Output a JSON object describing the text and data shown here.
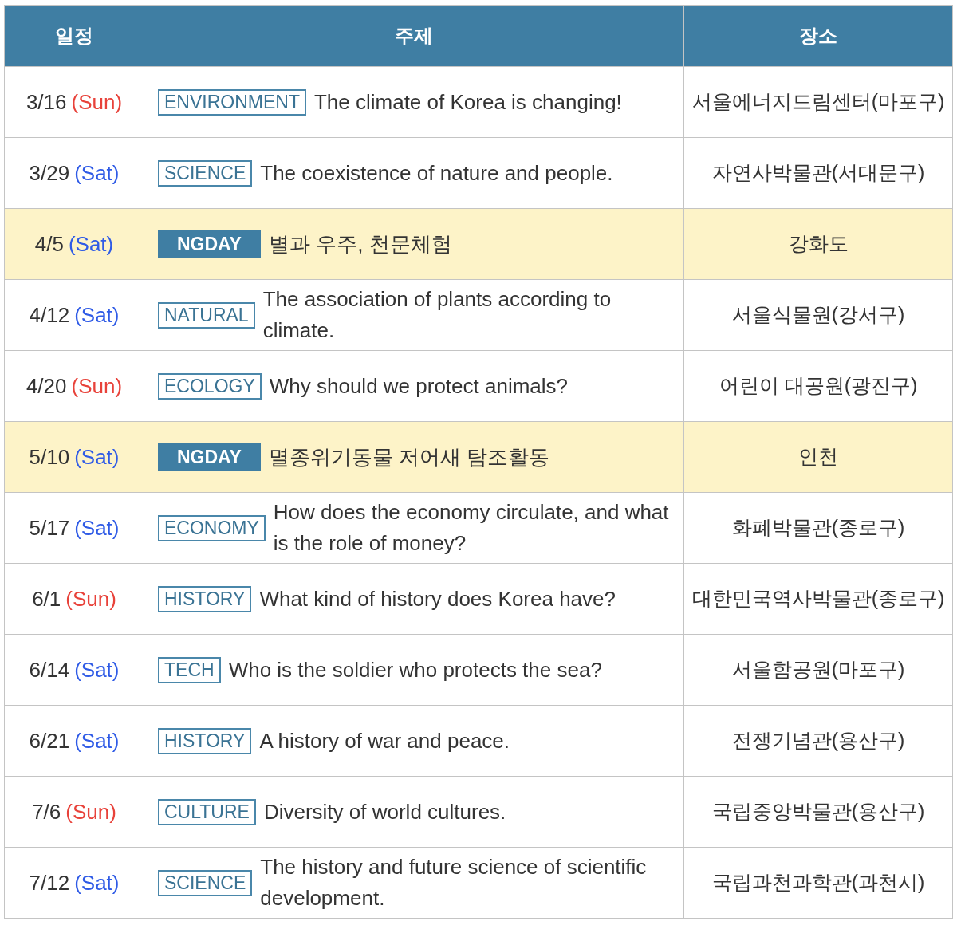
{
  "table": {
    "columns": [
      "일정",
      "주제",
      "장소"
    ],
    "rows": [
      {
        "date": "3/16",
        "day": "(Sun)",
        "color": "#e8423a",
        "tag": "ENVIRONMENT",
        "kind": "outline",
        "highlighted": false,
        "topic": "The climate of Korea is changing!",
        "place": "서울에너지드림센터(마포구)"
      },
      {
        "date": "3/29",
        "day": "(Sat)",
        "color": "#2f5be6",
        "tag": "SCIENCE",
        "kind": "outline",
        "highlighted": false,
        "topic": "The coexistence of nature and people.",
        "place": "자연사박물관(서대문구)"
      },
      {
        "date": "4/5",
        "day": "(Sat)",
        "color": "#2f5be6",
        "tag": "NGDAY",
        "kind": "filled",
        "highlighted": true,
        "topic": "별과 우주, 천문체험",
        "place": "강화도"
      },
      {
        "date": "4/12",
        "day": "(Sat)",
        "color": "#2f5be6",
        "tag": "NATURAL",
        "kind": "outline",
        "highlighted": false,
        "topic": "The association of plants according to climate.",
        "place": "서울식물원(강서구)"
      },
      {
        "date": "4/20",
        "day": "(Sun)",
        "color": "#e8423a",
        "tag": "ECOLOGY",
        "kind": "outline",
        "highlighted": false,
        "topic": "Why should we protect animals?",
        "place": "어린이 대공원(광진구)"
      },
      {
        "date": "5/10",
        "day": "(Sat)",
        "color": "#2f5be6",
        "tag": "NGDAY",
        "kind": "filled",
        "highlighted": true,
        "topic": "멸종위기동물 저어새 탐조활동",
        "place": "인천"
      },
      {
        "date": "5/17",
        "day": "(Sat)",
        "color": "#2f5be6",
        "tag": "ECONOMY",
        "kind": "outline",
        "highlighted": false,
        "topic": "How does the economy circulate, and what is the role of money?",
        "place": "화폐박물관(종로구)"
      },
      {
        "date": "6/1",
        "day": "(Sun)",
        "color": "#e8423a",
        "tag": "HISTORY",
        "kind": "outline",
        "highlighted": false,
        "topic": "What kind of history does Korea have?",
        "place": "대한민국역사박물관(종로구)"
      },
      {
        "date": "6/14",
        "day": "(Sat)",
        "color": "#2f5be6",
        "tag": "TECH",
        "kind": "outline",
        "highlighted": false,
        "topic": "Who is the soldier who protects the sea?",
        "place": "서울함공원(마포구)"
      },
      {
        "date": "6/21",
        "day": "(Sat)",
        "color": "#2f5be6",
        "tag": "HISTORY",
        "kind": "outline",
        "highlighted": false,
        "topic": "A history of war and peace.",
        "place": "전쟁기념관(용산구)"
      },
      {
        "date": "7/6",
        "day": "(Sun)",
        "color": "#e8423a",
        "tag": "CULTURE",
        "kind": "outline",
        "highlighted": false,
        "topic": "Diversity of world cultures.",
        "place": "국립중앙박물관(용산구)"
      },
      {
        "date": "7/12",
        "day": "(Sat)",
        "color": "#2f5be6",
        "tag": "SCIENCE",
        "kind": "outline",
        "highlighted": false,
        "topic": "The history and future science of scientific development.",
        "place": "국립과천과학관(과천시)"
      }
    ]
  }
}
